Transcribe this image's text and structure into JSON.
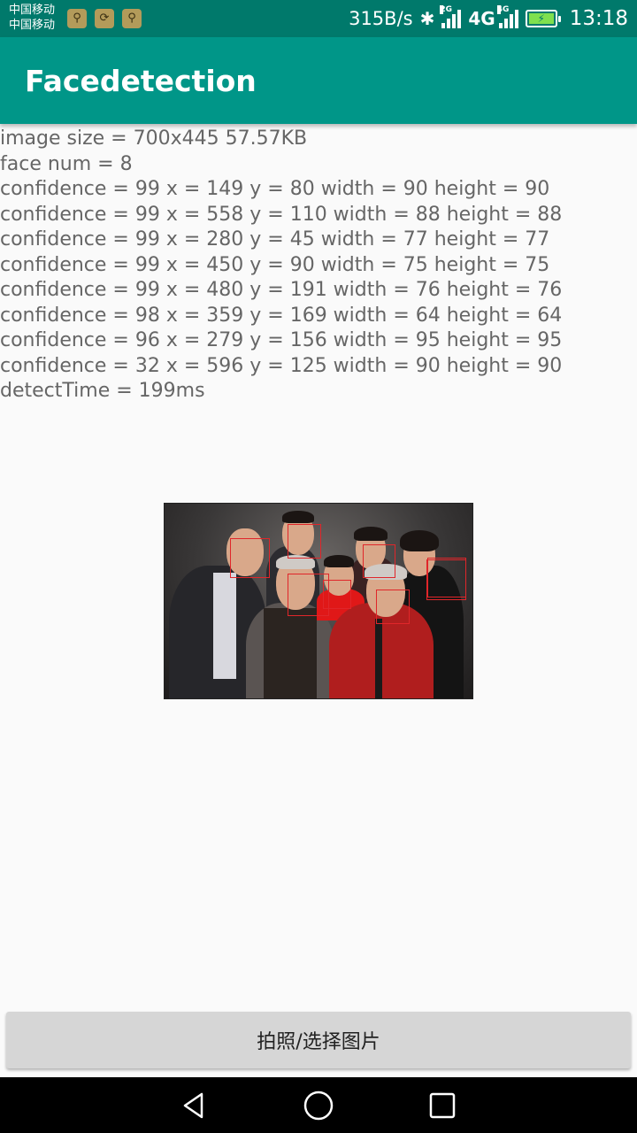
{
  "status_bar": {
    "carrier_1": "中国移动",
    "carrier_2": "中国移动",
    "net_speed": "315B/s",
    "network_2g": "2G",
    "network_4g_big": "4G",
    "network_4g_small": "4G",
    "time": "13:18",
    "icons": [
      "usb-icon",
      "sync-icon",
      "usb-icon",
      "bluetooth-icon",
      "signal-icon",
      "signal-icon",
      "battery-charging-icon"
    ]
  },
  "app_bar": {
    "title": "Facedetection"
  },
  "results": {
    "image_size": "image size = 700x445 57.57KB",
    "face_num": "face num = 8",
    "faces": [
      "confidence = 99 x = 149 y = 80 width = 90 height = 90",
      "confidence = 99 x = 558 y = 110 width = 88 height = 88",
      "confidence = 99 x = 280 y = 45 width = 77 height = 77",
      "confidence = 99 x = 450 y = 90 width = 75 height = 75",
      "confidence = 99 x = 480 y = 191 width = 76 height = 76",
      "confidence = 98 x = 359 y = 169 width = 64 height = 64",
      "confidence = 96 x = 279 y = 156 width = 95 height = 95",
      "confidence = 32 x = 596 y = 125 width = 90 height = 90"
    ],
    "detect_time": "detectTime = 199ms"
  },
  "action_button": {
    "label": "拍照/选择图片"
  },
  "nav_bar": {
    "icons": [
      "back-icon",
      "home-icon",
      "recents-icon"
    ]
  },
  "colors": {
    "status_bar": "#00796b",
    "app_bar": "#009688",
    "face_box": "#e0262a"
  }
}
